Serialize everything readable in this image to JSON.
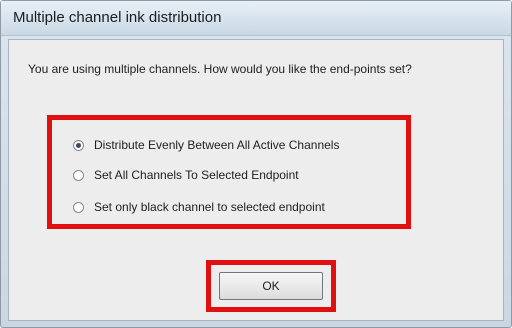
{
  "dialog": {
    "title": "Multiple channel ink distribution",
    "prompt": "You are using multiple channels. How would you like the end-points set?",
    "options": [
      {
        "label": "Distribute Evenly Between All Active Channels",
        "selected": true
      },
      {
        "label": "Set All Channels To Selected Endpoint",
        "selected": false
      },
      {
        "label": "Set only black channel to selected endpoint",
        "selected": false
      }
    ],
    "ok_label": "OK",
    "highlight_color": "#e01010"
  }
}
